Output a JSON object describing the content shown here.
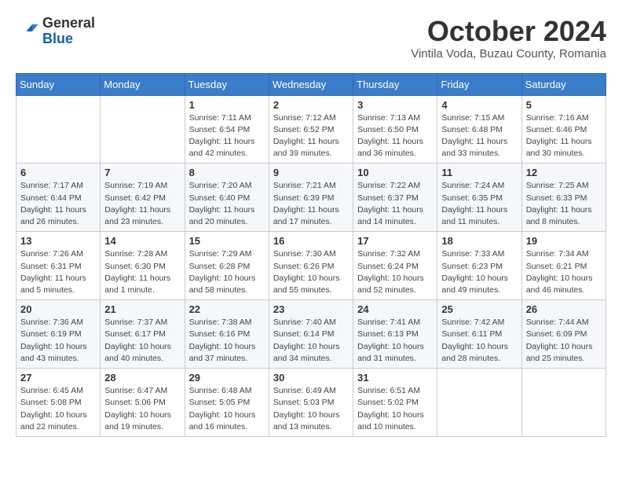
{
  "header": {
    "logo_general": "General",
    "logo_blue": "Blue",
    "month_title": "October 2024",
    "subtitle": "Vintila Voda, Buzau County, Romania"
  },
  "days_of_week": [
    "Sunday",
    "Monday",
    "Tuesday",
    "Wednesday",
    "Thursday",
    "Friday",
    "Saturday"
  ],
  "weeks": [
    [
      {
        "day": "",
        "info": ""
      },
      {
        "day": "",
        "info": ""
      },
      {
        "day": "1",
        "info": "Sunrise: 7:11 AM\nSunset: 6:54 PM\nDaylight: 11 hours and 42 minutes."
      },
      {
        "day": "2",
        "info": "Sunrise: 7:12 AM\nSunset: 6:52 PM\nDaylight: 11 hours and 39 minutes."
      },
      {
        "day": "3",
        "info": "Sunrise: 7:13 AM\nSunset: 6:50 PM\nDaylight: 11 hours and 36 minutes."
      },
      {
        "day": "4",
        "info": "Sunrise: 7:15 AM\nSunset: 6:48 PM\nDaylight: 11 hours and 33 minutes."
      },
      {
        "day": "5",
        "info": "Sunrise: 7:16 AM\nSunset: 6:46 PM\nDaylight: 11 hours and 30 minutes."
      }
    ],
    [
      {
        "day": "6",
        "info": "Sunrise: 7:17 AM\nSunset: 6:44 PM\nDaylight: 11 hours and 26 minutes."
      },
      {
        "day": "7",
        "info": "Sunrise: 7:19 AM\nSunset: 6:42 PM\nDaylight: 11 hours and 23 minutes."
      },
      {
        "day": "8",
        "info": "Sunrise: 7:20 AM\nSunset: 6:40 PM\nDaylight: 11 hours and 20 minutes."
      },
      {
        "day": "9",
        "info": "Sunrise: 7:21 AM\nSunset: 6:39 PM\nDaylight: 11 hours and 17 minutes."
      },
      {
        "day": "10",
        "info": "Sunrise: 7:22 AM\nSunset: 6:37 PM\nDaylight: 11 hours and 14 minutes."
      },
      {
        "day": "11",
        "info": "Sunrise: 7:24 AM\nSunset: 6:35 PM\nDaylight: 11 hours and 11 minutes."
      },
      {
        "day": "12",
        "info": "Sunrise: 7:25 AM\nSunset: 6:33 PM\nDaylight: 11 hours and 8 minutes."
      }
    ],
    [
      {
        "day": "13",
        "info": "Sunrise: 7:26 AM\nSunset: 6:31 PM\nDaylight: 11 hours and 5 minutes."
      },
      {
        "day": "14",
        "info": "Sunrise: 7:28 AM\nSunset: 6:30 PM\nDaylight: 11 hours and 1 minute."
      },
      {
        "day": "15",
        "info": "Sunrise: 7:29 AM\nSunset: 6:28 PM\nDaylight: 10 hours and 58 minutes."
      },
      {
        "day": "16",
        "info": "Sunrise: 7:30 AM\nSunset: 6:26 PM\nDaylight: 10 hours and 55 minutes."
      },
      {
        "day": "17",
        "info": "Sunrise: 7:32 AM\nSunset: 6:24 PM\nDaylight: 10 hours and 52 minutes."
      },
      {
        "day": "18",
        "info": "Sunrise: 7:33 AM\nSunset: 6:23 PM\nDaylight: 10 hours and 49 minutes."
      },
      {
        "day": "19",
        "info": "Sunrise: 7:34 AM\nSunset: 6:21 PM\nDaylight: 10 hours and 46 minutes."
      }
    ],
    [
      {
        "day": "20",
        "info": "Sunrise: 7:36 AM\nSunset: 6:19 PM\nDaylight: 10 hours and 43 minutes."
      },
      {
        "day": "21",
        "info": "Sunrise: 7:37 AM\nSunset: 6:17 PM\nDaylight: 10 hours and 40 minutes."
      },
      {
        "day": "22",
        "info": "Sunrise: 7:38 AM\nSunset: 6:16 PM\nDaylight: 10 hours and 37 minutes."
      },
      {
        "day": "23",
        "info": "Sunrise: 7:40 AM\nSunset: 6:14 PM\nDaylight: 10 hours and 34 minutes."
      },
      {
        "day": "24",
        "info": "Sunrise: 7:41 AM\nSunset: 6:13 PM\nDaylight: 10 hours and 31 minutes."
      },
      {
        "day": "25",
        "info": "Sunrise: 7:42 AM\nSunset: 6:11 PM\nDaylight: 10 hours and 28 minutes."
      },
      {
        "day": "26",
        "info": "Sunrise: 7:44 AM\nSunset: 6:09 PM\nDaylight: 10 hours and 25 minutes."
      }
    ],
    [
      {
        "day": "27",
        "info": "Sunrise: 6:45 AM\nSunset: 5:08 PM\nDaylight: 10 hours and 22 minutes."
      },
      {
        "day": "28",
        "info": "Sunrise: 6:47 AM\nSunset: 5:06 PM\nDaylight: 10 hours and 19 minutes."
      },
      {
        "day": "29",
        "info": "Sunrise: 6:48 AM\nSunset: 5:05 PM\nDaylight: 10 hours and 16 minutes."
      },
      {
        "day": "30",
        "info": "Sunrise: 6:49 AM\nSunset: 5:03 PM\nDaylight: 10 hours and 13 minutes."
      },
      {
        "day": "31",
        "info": "Sunrise: 6:51 AM\nSunset: 5:02 PM\nDaylight: 10 hours and 10 minutes."
      },
      {
        "day": "",
        "info": ""
      },
      {
        "day": "",
        "info": ""
      }
    ]
  ]
}
